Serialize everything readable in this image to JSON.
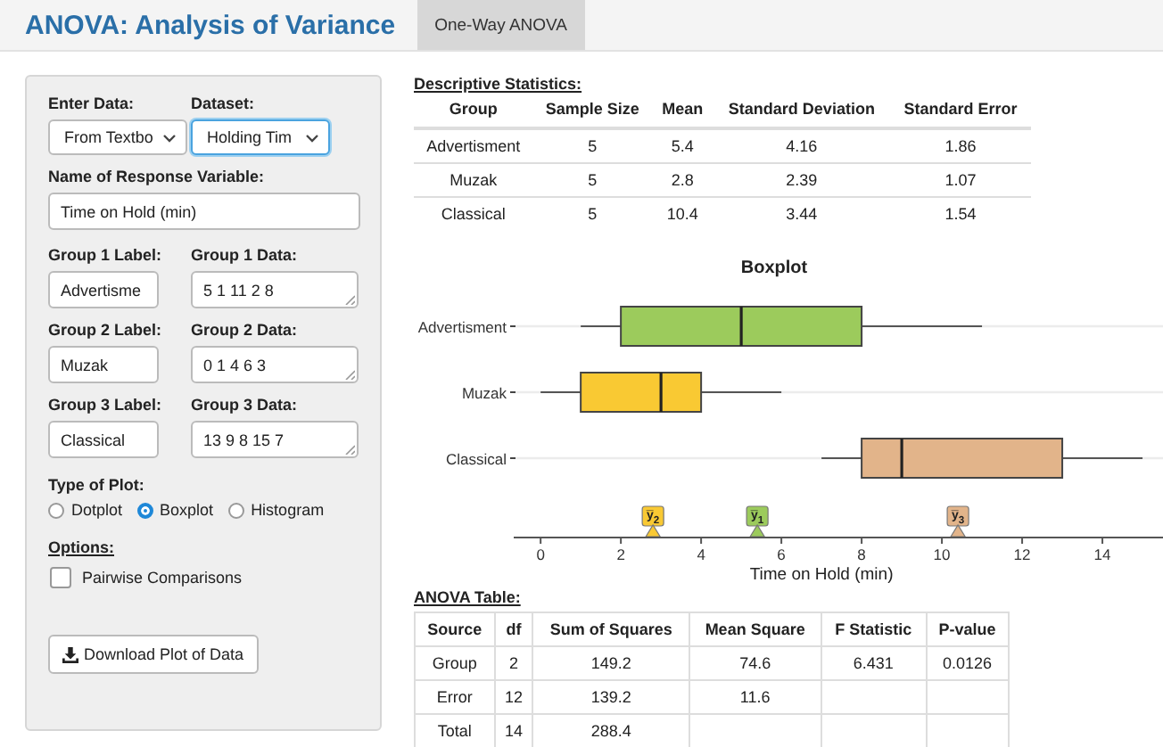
{
  "app_title": "ANOVA: Analysis of Variance",
  "tabs": [
    {
      "label": "One-Way ANOVA",
      "selected": true
    }
  ],
  "sidebar": {
    "enter_data": {
      "label": "Enter Data:",
      "value": "From Textbo"
    },
    "dataset": {
      "label": "Dataset:",
      "value": "Holding Tim",
      "focused": true
    },
    "response": {
      "label": "Name of Response Variable:",
      "value": "Time on Hold (min)"
    },
    "groups": [
      {
        "label_caption": "Group 1 Label:",
        "label_value": "Advertisme",
        "data_caption": "Group 1 Data:",
        "data_value": "5 1 11 2 8"
      },
      {
        "label_caption": "Group 2 Label:",
        "label_value": "Muzak",
        "data_caption": "Group 2 Data:",
        "data_value": "0 1 4 6 3"
      },
      {
        "label_caption": "Group 3 Label:",
        "label_value": "Classical",
        "data_caption": "Group 3 Data:",
        "data_value": "13 9 8 15 7"
      }
    ],
    "plot_type": {
      "label": "Type of Plot:",
      "options": [
        {
          "label": "Dotplot",
          "selected": false
        },
        {
          "label": "Boxplot",
          "selected": true
        },
        {
          "label": "Histogram",
          "selected": false
        }
      ]
    },
    "options": {
      "label": "Options:",
      "items": [
        {
          "label": "Pairwise Comparisons",
          "checked": false
        }
      ]
    },
    "download_button": "Download Plot of Data"
  },
  "descriptive": {
    "title": "Descriptive Statistics:",
    "columns": [
      "Group",
      "Sample Size",
      "Mean",
      "Standard Deviation",
      "Standard Error"
    ],
    "rows": [
      [
        "Advertisment",
        "5",
        "5.4",
        "4.16",
        "1.86"
      ],
      [
        "Muzak",
        "5",
        "2.8",
        "2.39",
        "1.07"
      ],
      [
        "Classical",
        "5",
        "10.4",
        "3.44",
        "1.54"
      ]
    ]
  },
  "boxplot": {
    "chart_data": {
      "type": "box",
      "orientation": "horizontal",
      "title": "Boxplot",
      "xlabel": "Time on Hold (min)",
      "categories": [
        "Advertisment",
        "Muzak",
        "Classical"
      ],
      "annotations": [
        {
          "text": "y̅$_{2}$",
          "x": 2.8
        },
        {
          "text": "y̅$_{1}$",
          "x": 5.4
        },
        {
          "text": "y̅$_{3}$",
          "x": 10.4
        }
      ],
      "xlim": [
        -0.67,
        15.51
      ],
      "xticks": [
        {
          "value": 0,
          "label": "0"
        },
        {
          "value": 2,
          "label": "2"
        },
        {
          "value": 4,
          "label": "4"
        },
        {
          "value": 6,
          "label": "6"
        },
        {
          "value": 8,
          "label": "8"
        },
        {
          "value": 10,
          "label": "10"
        },
        {
          "value": 12,
          "label": "12"
        },
        {
          "value": 14,
          "label": "14"
        }
      ]
    },
    "groups": [
      {
        "color": "#9ccb5c"
      },
      {
        "color": "#f9c933"
      },
      {
        "color": "#e2b48a"
      }
    ],
    "mean_markers": [
      {
        "color": "#f9c933"
      },
      {
        "color": "#9ccb5c"
      },
      {
        "color": "#e2b48a"
      }
    ]
  },
  "anova": {
    "title": "ANOVA Table:",
    "columns": [
      "Source",
      "df",
      "Sum of Squares",
      "Mean Square",
      "F Statistic",
      "P-value"
    ],
    "rows": [
      [
        "Group",
        "2",
        "149.2",
        "74.6",
        "6.431",
        "0.0126"
      ],
      [
        "Error",
        "12",
        "139.2",
        "11.6",
        "",
        ""
      ],
      [
        "Total",
        "14",
        "288.4",
        "",
        "",
        ""
      ]
    ]
  }
}
